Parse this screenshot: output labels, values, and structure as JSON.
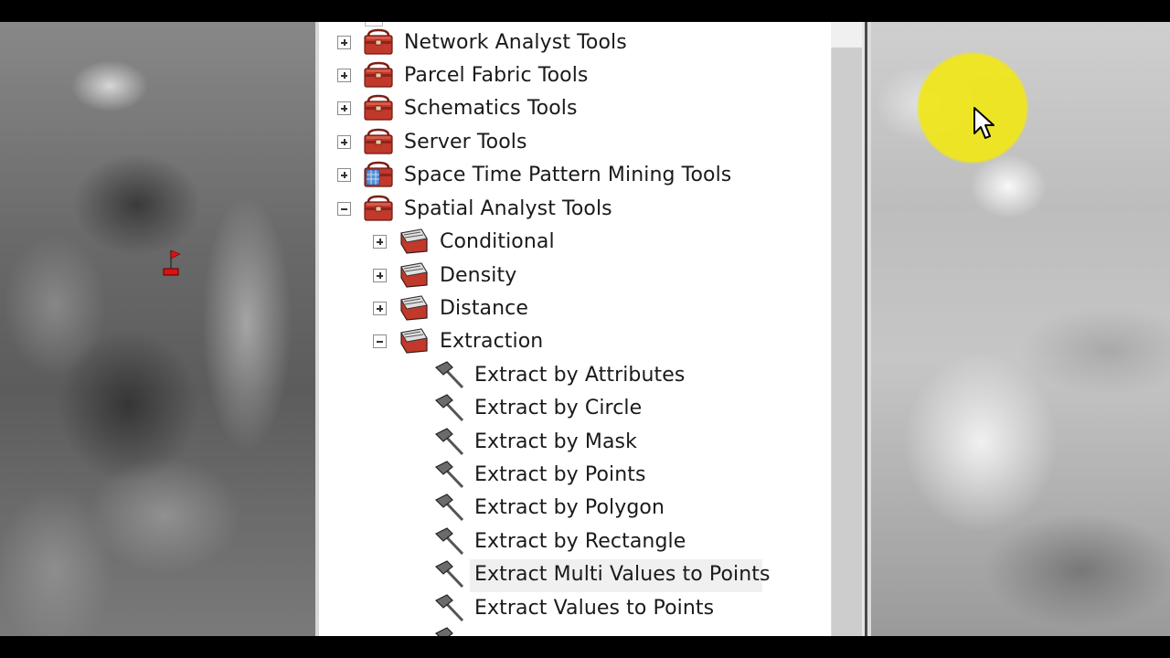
{
  "toolbox_tree": {
    "top_items": [
      {
        "label": "Network Analyst Tools",
        "state": "collapsed",
        "icon": "toolbox-icon"
      },
      {
        "label": "Parcel Fabric Tools",
        "state": "collapsed",
        "icon": "toolbox-icon"
      },
      {
        "label": "Schematics Tools",
        "state": "collapsed",
        "icon": "toolbox-icon"
      },
      {
        "label": "Server Tools",
        "state": "collapsed",
        "icon": "toolbox-icon"
      },
      {
        "label": "Space Time Pattern Mining Tools",
        "state": "collapsed",
        "icon": "space-time-toolbox-icon"
      },
      {
        "label": "Spatial Analyst Tools",
        "state": "expanded",
        "icon": "toolbox-icon"
      }
    ],
    "spatial_analyst_toolsets": [
      {
        "label": "Conditional",
        "state": "collapsed",
        "icon": "toolset-icon"
      },
      {
        "label": "Density",
        "state": "collapsed",
        "icon": "toolset-icon"
      },
      {
        "label": "Distance",
        "state": "collapsed",
        "icon": "toolset-icon"
      },
      {
        "label": "Extraction",
        "state": "expanded",
        "icon": "toolset-icon"
      }
    ],
    "extraction_tools": [
      {
        "label": "Extract by Attributes",
        "icon": "hammer-icon"
      },
      {
        "label": "Extract by Circle",
        "icon": "hammer-icon"
      },
      {
        "label": "Extract by Mask",
        "icon": "hammer-icon"
      },
      {
        "label": "Extract by Points",
        "icon": "hammer-icon"
      },
      {
        "label": "Extract by Polygon",
        "icon": "hammer-icon"
      },
      {
        "label": "Extract by Rectangle",
        "icon": "hammer-icon"
      },
      {
        "label": "Extract Multi Values to Points",
        "icon": "hammer-icon",
        "selected": true
      },
      {
        "label": "Extract Values to Points",
        "icon": "hammer-icon"
      }
    ]
  },
  "colors": {
    "toolbox_red": "#c0392b",
    "cursor_highlight": "#f0e61e",
    "selection_bg": "#f0f0f0"
  }
}
